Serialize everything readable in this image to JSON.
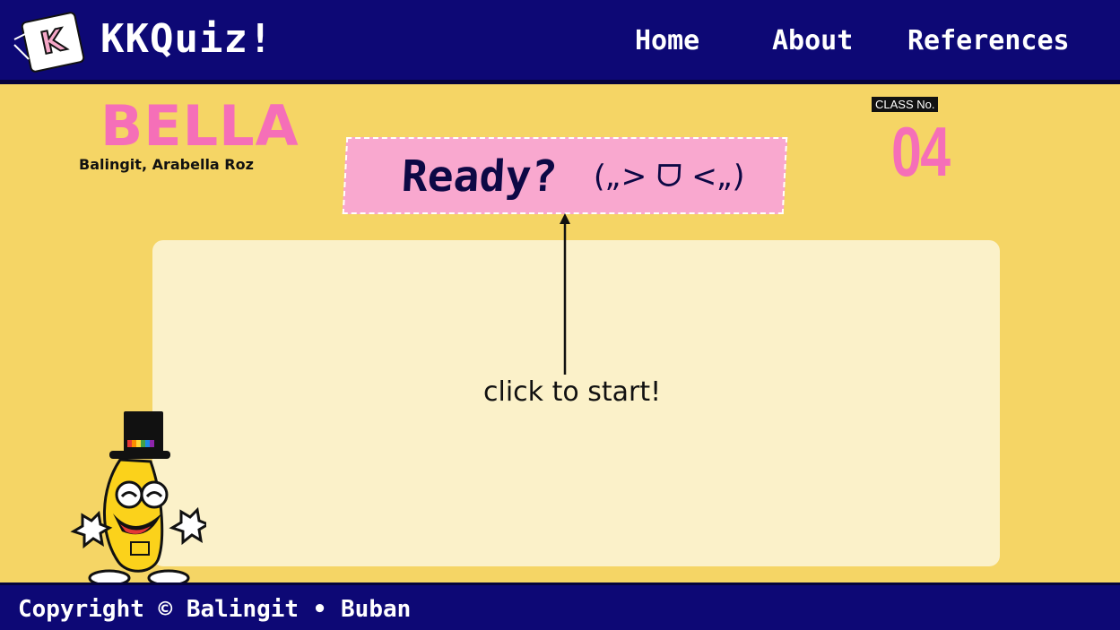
{
  "header": {
    "logo_letter": "K",
    "title": "KKQuiz!",
    "nav": {
      "home": "Home",
      "about": "About",
      "references": "References"
    }
  },
  "student": {
    "nickname": "BELLA",
    "full_name": "Balingit, Arabella Roz",
    "class_label": "CLASS No.",
    "class_number": "04"
  },
  "banner": {
    "label": "Ready?",
    "kaomoji": "(„> ᗜ <„)"
  },
  "main": {
    "instruction": "click to start!"
  },
  "footer": {
    "copyright": "Copyright © Balingit • Buban"
  },
  "colors": {
    "navy": "#0d0875",
    "background": "#f5d565",
    "pink": "#f56fb8",
    "banner_pink": "#f9a8cf",
    "panel": "#fbf1c9"
  },
  "icons": {
    "logo": "k-logo-icon",
    "mascot": "dancing-banana-icon",
    "arrow": "arrow-up-icon"
  }
}
